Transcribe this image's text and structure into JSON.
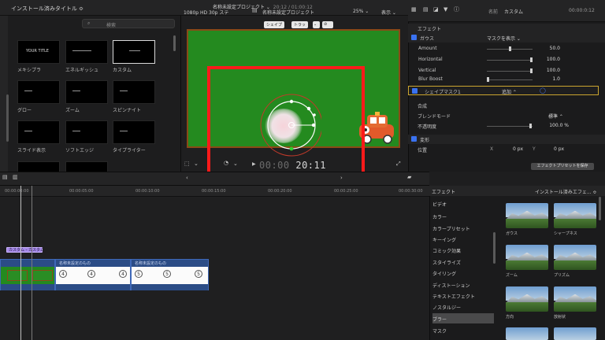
{
  "browser": {
    "title": "インストール済みタイトル ≎",
    "search_placeholder": "検索",
    "items": [
      {
        "label": "メキシプラ",
        "caption": "YOUR TITLE"
      },
      {
        "label": "エネルギッシュ",
        "caption": ""
      },
      {
        "label": "カスタム",
        "caption": ""
      },
      {
        "label": "グロー",
        "caption": ""
      },
      {
        "label": "ズーム",
        "caption": ""
      },
      {
        "label": "スピンナイト",
        "caption": ""
      },
      {
        "label": "スライド表示",
        "caption": ""
      },
      {
        "label": "ソフトエッジ",
        "caption": ""
      },
      {
        "label": "タイプライター",
        "caption": ""
      }
    ]
  },
  "viewer": {
    "format": "1080p HD 30p ステ",
    "project": "名称未設定プロジェクト",
    "zoom": "25% ⌄",
    "view_menu": "表示 ⌄",
    "tool_shape": "シェイプ",
    "tool_transform": "トラッ",
    "timecode_dim": "00:00",
    "timecode": "20:11"
  },
  "inspector": {
    "header_name": "名前",
    "header_value": "カスタム",
    "header_time": "00:00:0:12",
    "effects_label": "エフェクト",
    "blur_name": "ガウス",
    "mask_display": "マスクを表示 ⌄",
    "params": [
      {
        "label": "Amount",
        "value": "50.0",
        "knob": 0.5
      },
      {
        "label": "Horizontal",
        "value": "100.0",
        "knob": 1.0
      },
      {
        "label": "Vertical",
        "value": "100.0",
        "knob": 1.0
      },
      {
        "label": "Blur Boost",
        "value": "1.0",
        "knob": 0.0
      }
    ],
    "shape_mask": "シェイプマスク1",
    "shape_mask_mode": "追加 ⌃",
    "composite": "合成",
    "blend_mode_label": "ブレンドモード",
    "blend_mode_value": "標準 ⌃",
    "opacity_label": "不透明度",
    "opacity_value": "100.0 %",
    "transform_label": "変形",
    "position_label": "位置",
    "position_x_label": "X",
    "position_x": "0 px",
    "position_y_label": "Y",
    "position_y": "0 px",
    "preset_button": "エフェクトプリセットを保存"
  },
  "timeline": {
    "project_title": "名称未設定プロジェクト",
    "project_time": "20:12 / 01:00:12",
    "ruler": [
      "00:00:00:00",
      "00:00:05:00",
      "00:00:10:00",
      "00:00:15:00",
      "00:00:20:00",
      "00:00:25:00",
      "00:00:30:00"
    ],
    "title_clip": "カスタム - カスタム",
    "clips": [
      {
        "name": "名称未設定のもの",
        "numbers": [
          "4",
          "4",
          "4"
        ]
      },
      {
        "name": "名称未設定のもの",
        "numbers": [
          "5",
          "5",
          "5"
        ]
      }
    ]
  },
  "effects": {
    "header": "エフェクト",
    "categories": [
      "ビデオ",
      "カラー",
      "カラープリセット",
      "キーイング",
      "コミック効果",
      "スタイライズ",
      "タイリング",
      "ディストーション",
      "テキストエフェクト",
      "ノスタルジー",
      "ブラー",
      "マスク"
    ],
    "selected_category": "ブラー",
    "browser_title": "インストール済みエフェ... ≎",
    "thumbs": [
      "ガウス",
      "シャープネス",
      "ズーム",
      "プリズム",
      "方向",
      "放射状"
    ]
  }
}
